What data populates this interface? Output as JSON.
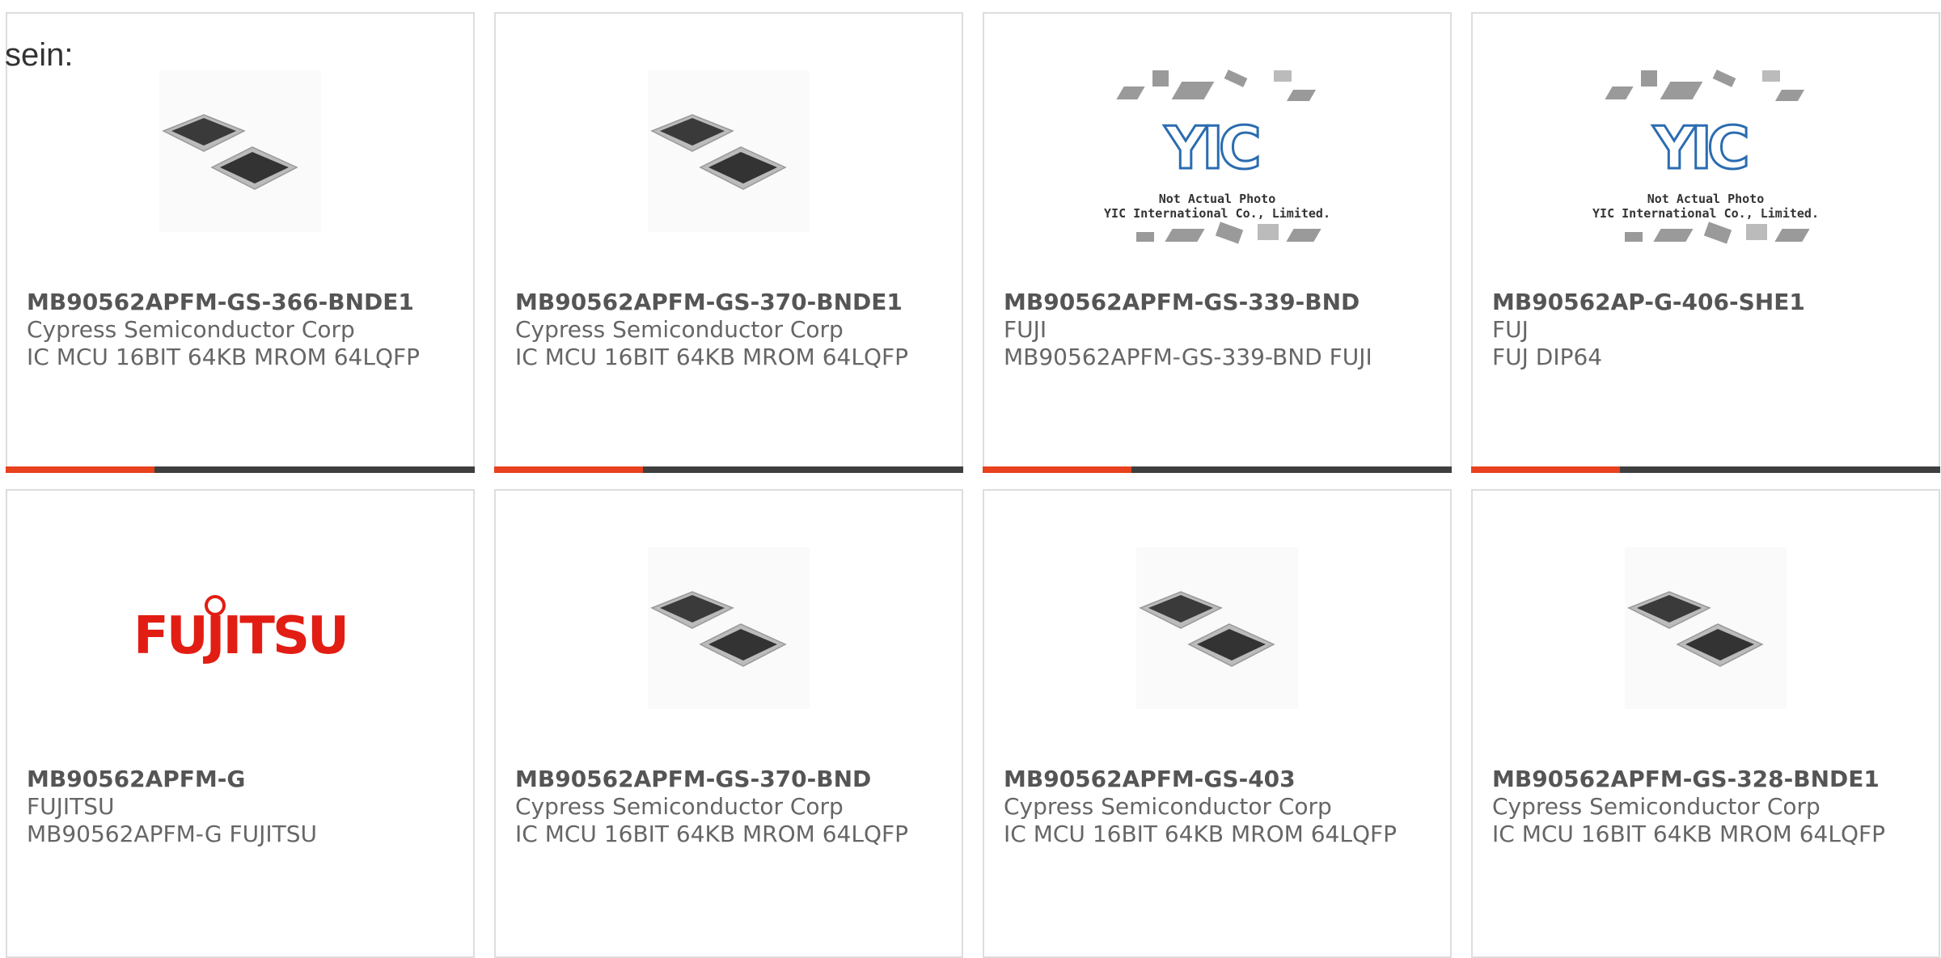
{
  "intro_text": "sein:",
  "colors": {
    "accent": "#e8411d",
    "bar": "#3f3f3f",
    "border": "#dddddd",
    "fujitsu_red": "#e21d13"
  },
  "products": [
    {
      "name": "MB90562APFM-GS-366-BNDE1",
      "maker": "Cypress Semiconductor Corp",
      "desc": "IC MCU 16BIT 64KB MROM 64LQFP",
      "image": "chip-icon"
    },
    {
      "name": "MB90562APFM-GS-370-BNDE1",
      "maker": "Cypress Semiconductor Corp",
      "desc": "IC MCU 16BIT 64KB MROM 64LQFP",
      "image": "chip-icon"
    },
    {
      "name": "MB90562APFM-GS-339-BND",
      "maker": "FUJI",
      "desc": "MB90562APFM-GS-339-BND FUJI",
      "image": "yic-placeholder"
    },
    {
      "name": "MB90562AP-G-406-SHE1",
      "maker": "FUJ",
      "desc": "FUJ DIP64",
      "image": "yic-placeholder"
    },
    {
      "name": "MB90562APFM-G",
      "maker": "FUJITSU",
      "desc": "MB90562APFM-G FUJITSU",
      "image": "fujitsu-logo"
    },
    {
      "name": "MB90562APFM-GS-370-BND",
      "maker": "Cypress Semiconductor Corp",
      "desc": "IC MCU 16BIT 64KB MROM 64LQFP",
      "image": "chip-icon"
    },
    {
      "name": "MB90562APFM-GS-403",
      "maker": "Cypress Semiconductor Corp",
      "desc": "IC MCU 16BIT 64KB MROM 64LQFP",
      "image": "chip-icon"
    },
    {
      "name": "MB90562APFM-GS-328-BNDE1",
      "maker": "Cypress Semiconductor Corp",
      "desc": "IC MCU 16BIT 64KB MROM 64LQFP",
      "image": "chip-icon"
    }
  ],
  "placeholder": {
    "logo": "YIC",
    "line1": "Not Actual Photo",
    "line2": "YIC International Co., Limited."
  },
  "fujitsu_logo_text": "FUJITSU"
}
